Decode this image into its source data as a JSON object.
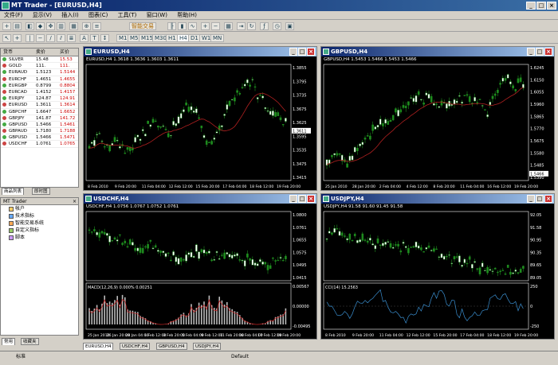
{
  "app": {
    "title": "MT Trader - [EURUSD,H4]"
  },
  "menu": [
    "文件(F)",
    "显示(V)",
    "插入(I)",
    "图表(C)",
    "工具(T)",
    "窗口(W)",
    "帮助(H)"
  ],
  "toolbar": {
    "timeframes": [
      "M1",
      "M5",
      "M15",
      "M30",
      "H1",
      "H4",
      "D1",
      "W1",
      "MN"
    ],
    "autotrade": "智能交易"
  },
  "market_watch": {
    "headers": [
      "货币",
      "卖价",
      "买价"
    ],
    "rows": [
      {
        "sym": "SILVER",
        "bid": "15.48",
        "ask": "15.53"
      },
      {
        "sym": "GOLD",
        "bid": "111.",
        "ask": "111."
      },
      {
        "sym": "EURAUD",
        "bid": "1.5123",
        "ask": "1.5144"
      },
      {
        "sym": "EURCHF",
        "bid": "1.4651",
        "ask": "1.4655"
      },
      {
        "sym": "EURGBP",
        "bid": "0.8799",
        "ask": "0.8804"
      },
      {
        "sym": "EURCAD",
        "bid": "1.4152",
        "ask": "1.4157"
      },
      {
        "sym": "EURJPY",
        "bid": "124.87",
        "ask": "124.91"
      },
      {
        "sym": "EURUSD",
        "bid": "1.3611",
        "ask": "1.3614"
      },
      {
        "sym": "GBPCHF",
        "bid": "1.6647",
        "ask": "1.6652"
      },
      {
        "sym": "GBPJPY",
        "bid": "141.87",
        "ask": "141.72"
      },
      {
        "sym": "GBPUSD",
        "bid": "1.5466",
        "ask": "1.5461"
      },
      {
        "sym": "GBPAUD",
        "bid": "1.7180",
        "ask": "1.7188"
      },
      {
        "sym": "GBPUSD",
        "bid": "1.5466",
        "ask": "1.5471"
      },
      {
        "sym": "USDCHF",
        "bid": "1.0761",
        "ask": "1.0765"
      }
    ],
    "tabs": [
      "商品列表",
      "即时图"
    ]
  },
  "navigator": {
    "title": "MT Trader",
    "items": [
      "帐户",
      "技术指标",
      "智能交易系统",
      "自定义指标",
      "脚本"
    ],
    "tabs": [
      "常用",
      "收藏夹"
    ]
  },
  "charts": [
    {
      "title": "EURUSD,H4",
      "info": "EURUSD,H4  1.3618 1.3636 1.3603 1.3611",
      "prices": [
        "1.3855",
        "1.3795",
        "1.3735",
        "1.3675",
        "1.3625",
        "1.3595",
        "1.3535",
        "1.3475",
        "1.3415"
      ],
      "dates": [
        "8 Feb 2010",
        "9 Feb 20:00",
        "11 Feb 04:00",
        "12 Feb 12:00",
        "15 Feb 20:00",
        "17 Feb 04:00",
        "18 Feb 12:00",
        "19 Feb 20:00"
      ],
      "last": "1.3611"
    },
    {
      "title": "GBPUSD,H4",
      "info": "GBPUSD,H4  1.5453 1.5466 1.5453 1.5466",
      "prices": [
        "1.6245",
        "1.6150",
        "1.6055",
        "1.5960",
        "1.5865",
        "1.5770",
        "1.5675",
        "1.5580",
        "1.5485",
        "1.5390"
      ],
      "dates": [
        "25 Jan 2010",
        "28 Jan 20:00",
        "2 Feb 04:00",
        "4 Feb 12:00",
        "8 Feb 20:00",
        "11 Feb 04:00",
        "16 Feb 12:00",
        "19 Feb 20:00"
      ],
      "last": "1.5466"
    },
    {
      "title": "USDCHF,H4",
      "info": "USDCHF,H4  1.0756 1.0767 1.0752 1.0761",
      "prices": [
        "1.0800",
        "1.0761",
        "1.0655",
        "1.0575",
        "1.0495",
        "1.0415"
      ],
      "macd_label": "MACD(12,26,9) 0.000% 0.00251",
      "macd_prices": [
        "0.00567",
        "0.00000",
        "-0.00495"
      ],
      "dates": [
        "25 Jan 2010",
        "26 Jan 20:00",
        "28 Jan 04:00",
        "1 Feb 12:00",
        "3 Feb 20:00",
        "5 Feb 04:00",
        "9 Feb 12:00",
        "11 Feb 20:00",
        "16 Feb 04:00",
        "17 Feb 12:00",
        "19 Feb 20:00"
      ]
    },
    {
      "title": "USDJPY,H4",
      "info": "USDJPY,H4  91.58 91.60 91.45 91.58",
      "prices": [
        "92.05",
        "91.58",
        "90.95",
        "90.35",
        "89.65",
        "89.05"
      ],
      "cci_label": "CCI(14) 15.2563",
      "cci_prices": [
        "250",
        "0",
        "-250"
      ],
      "dates": [
        "8 Feb 2010",
        "9 Feb 20:00",
        "11 Feb 04:00",
        "12 Feb 12:00",
        "15 Feb 20:00",
        "17 Feb 04:00",
        "18 Feb 12:00",
        "19 Feb 20:00"
      ]
    }
  ],
  "chart_tabs": [
    "EURUSD,H4",
    "USDCHF,H4",
    "GBPUSD,H4",
    "USDJPY,H4"
  ],
  "status": {
    "left": "标准",
    "right": "Default"
  },
  "colors": {
    "candle_up": "#2e9b2e",
    "candle_down": "#0f0",
    "ma": "#b02020",
    "bg": "#000000"
  }
}
